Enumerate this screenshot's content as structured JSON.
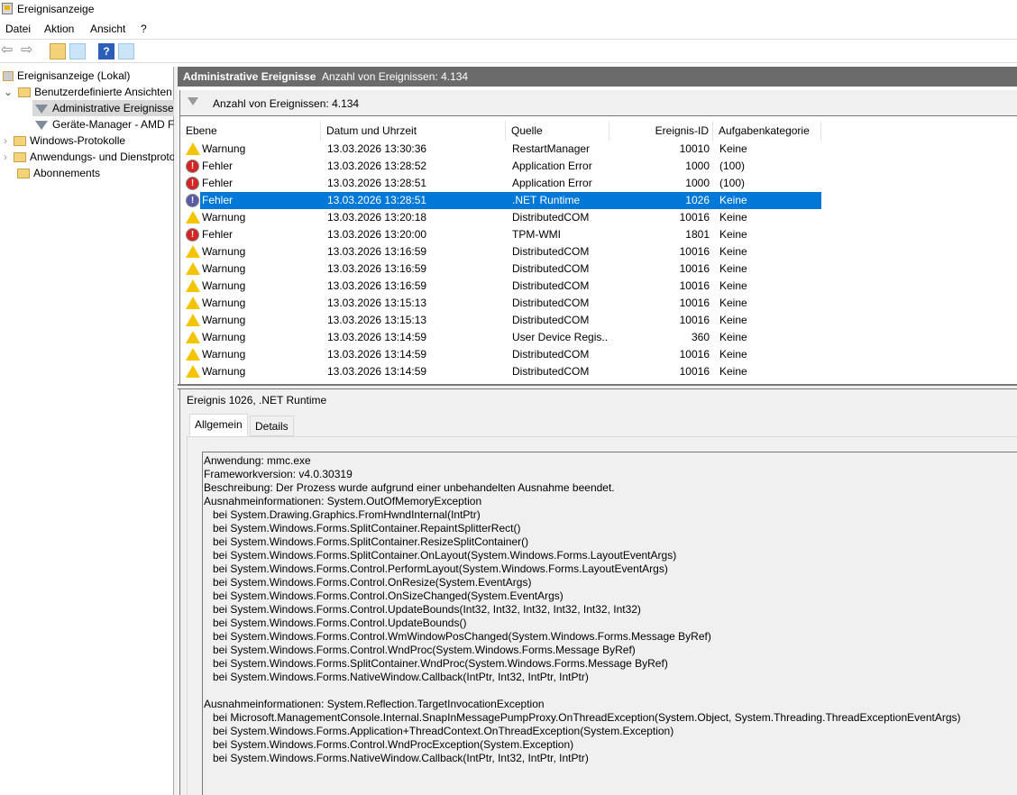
{
  "window": {
    "title": "Ereignisanzeige"
  },
  "menu": [
    "Datei",
    "Aktion",
    "Ansicht",
    "?"
  ],
  "tree": {
    "root": "Ereignisanzeige (Lokal)",
    "items": [
      {
        "label": "Benutzerdefinierte Ansichten",
        "expanded": true
      },
      {
        "label": "Administrative Ereignisse",
        "selected": true
      },
      {
        "label": "Geräte-Manager - AMD F"
      },
      {
        "label": "Windows-Protokolle"
      },
      {
        "label": "Anwendungs- und Dienstprotokolle"
      },
      {
        "label": "Abonnements"
      }
    ]
  },
  "header": {
    "title": "Administrative Ereignisse",
    "count": "Anzahl von Ereignissen: 4.134"
  },
  "filter": {
    "text": "Anzahl von Ereignissen: 4.134"
  },
  "columns": [
    "Ebene",
    "Datum und Uhrzeit",
    "Quelle",
    "Ereignis-ID",
    "Aufgabenkategorie"
  ],
  "rows": [
    {
      "level": "Warnung",
      "date": "13.03.2026 13:30:36",
      "source": "RestartManager",
      "id": "10010",
      "cat": "Keine"
    },
    {
      "level": "Fehler",
      "date": "13.03.2026 13:28:52",
      "source": "Application Error",
      "id": "1000",
      "cat": "(100)"
    },
    {
      "level": "Fehler",
      "date": "13.03.2026 13:28:51",
      "source": "Application Error",
      "id": "1000",
      "cat": "(100)"
    },
    {
      "level": "Fehler",
      "date": "13.03.2026 13:28:51",
      "source": ".NET Runtime",
      "id": "1026",
      "cat": "Keine",
      "selected": true
    },
    {
      "level": "Warnung",
      "date": "13.03.2026 13:20:18",
      "source": "DistributedCOM",
      "id": "10016",
      "cat": "Keine"
    },
    {
      "level": "Fehler",
      "date": "13.03.2026 13:20:00",
      "source": "TPM-WMI",
      "id": "1801",
      "cat": "Keine"
    },
    {
      "level": "Warnung",
      "date": "13.03.2026 13:16:59",
      "source": "DistributedCOM",
      "id": "10016",
      "cat": "Keine"
    },
    {
      "level": "Warnung",
      "date": "13.03.2026 13:16:59",
      "source": "DistributedCOM",
      "id": "10016",
      "cat": "Keine"
    },
    {
      "level": "Warnung",
      "date": "13.03.2026 13:16:59",
      "source": "DistributedCOM",
      "id": "10016",
      "cat": "Keine"
    },
    {
      "level": "Warnung",
      "date": "13.03.2026 13:15:13",
      "source": "DistributedCOM",
      "id": "10016",
      "cat": "Keine"
    },
    {
      "level": "Warnung",
      "date": "13.03.2026 13:15:13",
      "source": "DistributedCOM",
      "id": "10016",
      "cat": "Keine"
    },
    {
      "level": "Warnung",
      "date": "13.03.2026 13:14:59",
      "source": "User Device Regis...",
      "id": "360",
      "cat": "Keine"
    },
    {
      "level": "Warnung",
      "date": "13.03.2026 13:14:59",
      "source": "DistributedCOM",
      "id": "10016",
      "cat": "Keine"
    },
    {
      "level": "Warnung",
      "date": "13.03.2026 13:14:59",
      "source": "DistributedCOM",
      "id": "10016",
      "cat": "Keine"
    }
  ],
  "event": {
    "title": "Ereignis 1026, .NET Runtime",
    "tabs": [
      "Allgemein",
      "Details"
    ],
    "description": "Anwendung: mmc.exe\nFrameworkversion: v4.0.30319\nBeschreibung: Der Prozess wurde aufgrund einer unbehandelten Ausnahme beendet.\nAusnahmeinformationen: System.OutOfMemoryException\n   bei System.Drawing.Graphics.FromHwndInternal(IntPtr)\n   bei System.Windows.Forms.SplitContainer.RepaintSplitterRect()\n   bei System.Windows.Forms.SplitContainer.ResizeSplitContainer()\n   bei System.Windows.Forms.SplitContainer.OnLayout(System.Windows.Forms.LayoutEventArgs)\n   bei System.Windows.Forms.Control.PerformLayout(System.Windows.Forms.LayoutEventArgs)\n   bei System.Windows.Forms.Control.OnResize(System.EventArgs)\n   bei System.Windows.Forms.Control.OnSizeChanged(System.EventArgs)\n   bei System.Windows.Forms.Control.UpdateBounds(Int32, Int32, Int32, Int32, Int32, Int32)\n   bei System.Windows.Forms.Control.UpdateBounds()\n   bei System.Windows.Forms.Control.WmWindowPosChanged(System.Windows.Forms.Message ByRef)\n   bei System.Windows.Forms.Control.WndProc(System.Windows.Forms.Message ByRef)\n   bei System.Windows.Forms.SplitContainer.WndProc(System.Windows.Forms.Message ByRef)\n   bei System.Windows.Forms.NativeWindow.Callback(IntPtr, Int32, IntPtr, IntPtr)\n\nAusnahmeinformationen: System.Reflection.TargetInvocationException\n   bei Microsoft.ManagementConsole.Internal.SnapInMessagePumpProxy.OnThreadException(System.Object, System.Threading.ThreadExceptionEventArgs)\n   bei System.Windows.Forms.Application+ThreadContext.OnThreadException(System.Exception)\n   bei System.Windows.Forms.Control.WndProcException(System.Exception)\n   bei System.Windows.Forms.NativeWindow.Callback(IntPtr, Int32, IntPtr, IntPtr)"
  },
  "colors": {
    "selection": "#0078d7",
    "header": "#6b6b6b"
  }
}
